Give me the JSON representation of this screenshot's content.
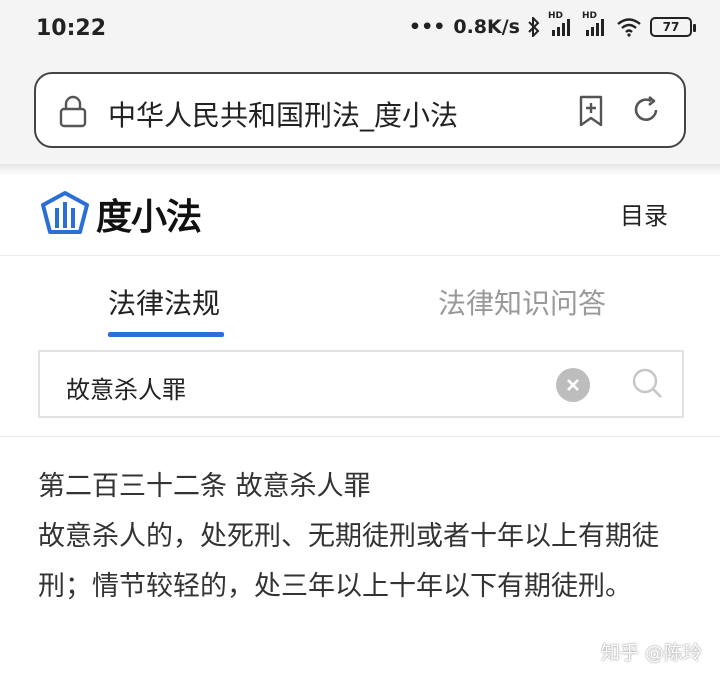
{
  "status_bar": {
    "time": "10:22",
    "network_speed": "0.8K/s",
    "signal_label_1": "HD",
    "signal_label_2": "HD",
    "battery": "77",
    "icons": [
      "dots-icon",
      "bluetooth-icon",
      "signal-icon",
      "signal-icon",
      "wifi-icon",
      "battery-icon"
    ]
  },
  "browser": {
    "title": "中华人民共和国刑法_度小法",
    "icons": [
      "lock-icon",
      "bookmark-add-icon",
      "refresh-icon"
    ]
  },
  "site_header": {
    "logo_text": "度小法",
    "menu_label": "目录",
    "brand_color": "#2b6fd6"
  },
  "tabs": [
    {
      "label": "法律法规",
      "active": true
    },
    {
      "label": "法律知识问答",
      "active": false
    }
  ],
  "search": {
    "value": "故意杀人罪"
  },
  "article": {
    "title": "第二百三十二条 故意杀人罪",
    "body": "故意杀人的，处死刑、无期徒刑或者十年以上有期徒刑；情节较轻的，处三年以上十年以下有期徒刑。"
  },
  "watermark": "知乎 @陈玲"
}
